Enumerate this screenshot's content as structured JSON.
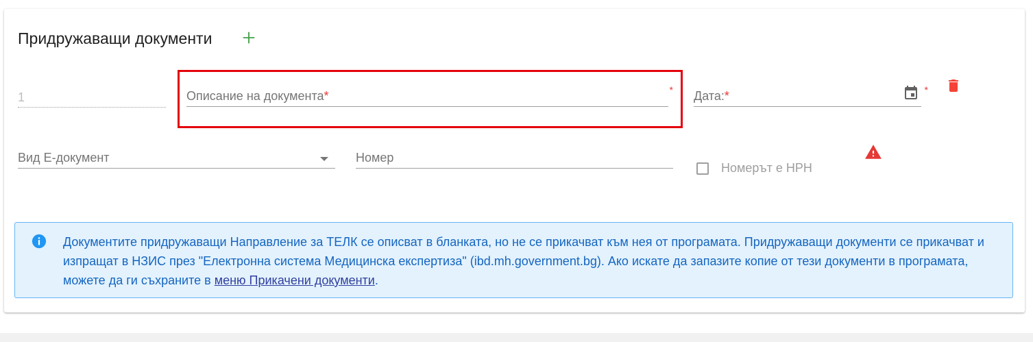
{
  "section": {
    "title": "Придружаващи документи",
    "row_number": "1",
    "description_placeholder": "Описание на документа",
    "date_placeholder": "Дата:",
    "required_mark": "*",
    "edoc_type_placeholder": "Вид Е-документ",
    "number_placeholder": "Номер",
    "nrn_checkbox_label": "Номерът е НРН",
    "nrn_checked": false
  },
  "info": {
    "text_before_link": "Документите придружаващи Направление за ТЕЛК се описват в бланката, но не се прикачват към нея от програмата. Придружаващи документи се прикачват и изпращат в НЗИС през \"Електронна система Медицинска експертиза\" (ibd.mh.government.bg). Ако искате да запазите копие от тези документи в програмата, можете да ги съхраните в ",
    "link_text": "меню Прикачени документи",
    "text_after_link": "."
  },
  "colors": {
    "highlight_border": "#e3000b",
    "add_icon": "#43a047",
    "trash_icon": "#f44336",
    "warning_icon": "#e53935",
    "info_background": "#e3f2fd",
    "info_text": "#1565c0"
  },
  "icons": [
    "add-icon",
    "calendar-icon",
    "trash-icon",
    "warning-icon",
    "info-icon",
    "chevron-down-icon"
  ]
}
